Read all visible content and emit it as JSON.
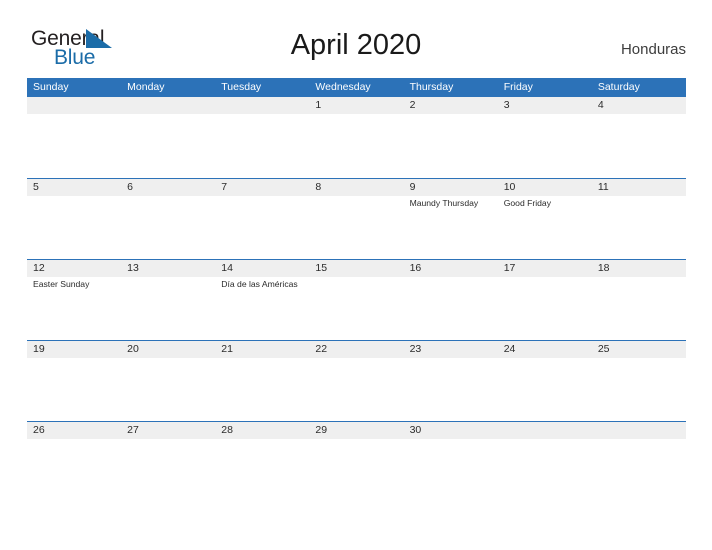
{
  "brand": {
    "name_part1": "General",
    "name_part2": "Blue",
    "mark": "triangle-flag-icon",
    "color_dark": "#231f20",
    "color_blue": "#1b6ca8"
  },
  "header": {
    "title": "April 2020",
    "country": "Honduras"
  },
  "theme": {
    "header_blue": "#2c72b8",
    "band_gray": "#efefef",
    "text_dark": "#2b2b2b"
  },
  "calendar": {
    "weekday_headers": [
      "Sunday",
      "Monday",
      "Tuesday",
      "Wednesday",
      "Thursday",
      "Friday",
      "Saturday"
    ],
    "weeks": [
      {
        "days": [
          {
            "num": "",
            "events": []
          },
          {
            "num": "",
            "events": []
          },
          {
            "num": "",
            "events": []
          },
          {
            "num": "1",
            "events": []
          },
          {
            "num": "2",
            "events": []
          },
          {
            "num": "3",
            "events": []
          },
          {
            "num": "4",
            "events": []
          }
        ]
      },
      {
        "days": [
          {
            "num": "5",
            "events": []
          },
          {
            "num": "6",
            "events": []
          },
          {
            "num": "7",
            "events": []
          },
          {
            "num": "8",
            "events": []
          },
          {
            "num": "9",
            "events": [
              "Maundy Thursday"
            ]
          },
          {
            "num": "10",
            "events": [
              "Good Friday"
            ]
          },
          {
            "num": "11",
            "events": []
          }
        ]
      },
      {
        "days": [
          {
            "num": "12",
            "events": [
              "Easter Sunday"
            ]
          },
          {
            "num": "13",
            "events": []
          },
          {
            "num": "14",
            "events": [
              "Día de las Américas"
            ]
          },
          {
            "num": "15",
            "events": []
          },
          {
            "num": "16",
            "events": []
          },
          {
            "num": "17",
            "events": []
          },
          {
            "num": "18",
            "events": []
          }
        ]
      },
      {
        "days": [
          {
            "num": "19",
            "events": []
          },
          {
            "num": "20",
            "events": []
          },
          {
            "num": "21",
            "events": []
          },
          {
            "num": "22",
            "events": []
          },
          {
            "num": "23",
            "events": []
          },
          {
            "num": "24",
            "events": []
          },
          {
            "num": "25",
            "events": []
          }
        ]
      },
      {
        "days": [
          {
            "num": "26",
            "events": []
          },
          {
            "num": "27",
            "events": []
          },
          {
            "num": "28",
            "events": []
          },
          {
            "num": "29",
            "events": []
          },
          {
            "num": "30",
            "events": []
          },
          {
            "num": "",
            "events": []
          },
          {
            "num": "",
            "events": []
          }
        ]
      }
    ]
  }
}
